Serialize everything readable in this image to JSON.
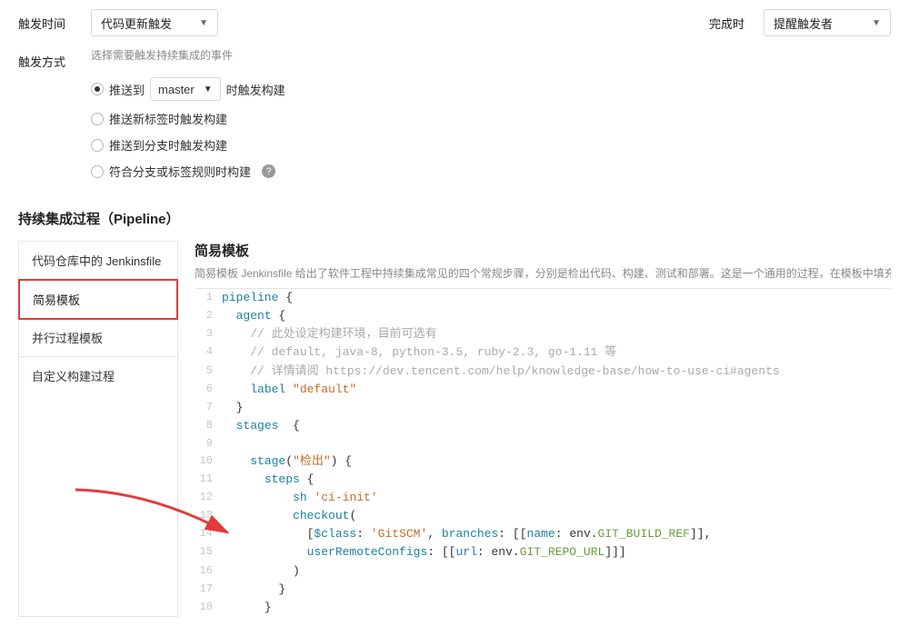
{
  "top": {
    "trigger_time_label": "触发时间",
    "trigger_time_value": "代码更新触发",
    "complete_label": "完成时",
    "complete_value": "提醒触发者"
  },
  "trigger_mode": {
    "label": "触发方式",
    "hint": "选择需要触发持续集成的事件",
    "opt1_prefix": "推送到",
    "opt1_branch": "master",
    "opt1_suffix": "时触发构建",
    "opt2": "推送新标签时触发构建",
    "opt3": "推送到分支时触发构建",
    "opt4": "符合分支或标签规则时构建"
  },
  "pipeline": {
    "heading": "持续集成过程（Pipeline）",
    "tabs": [
      "代码仓库中的 Jenkinsfile",
      "简易模板",
      "并行过程模板",
      "自定义构建过程"
    ],
    "content_title": "简易模板",
    "content_desc": "简易模板 Jenkinsfile 给出了软件工程中持续集成常见的四个常规步骤，分别是检出代码、构建、测试和部署。这是一个通用的过程，在模板中填充上对应的真实构建和部署过程即可轻松完成整个持续集"
  },
  "code": [
    {
      "n": "1",
      "t": "pipeline {",
      "c": "kw"
    },
    {
      "n": "2",
      "t": "  agent {",
      "c": "kw"
    },
    {
      "n": "3",
      "t": "    // 此处设定构建环境，目前可选有",
      "c": "cm"
    },
    {
      "n": "4",
      "t": "    // default, java-8, python-3.5, ruby-2.3, go-1.11 等",
      "c": "cm"
    },
    {
      "n": "5",
      "t": "    // 详情请阅 https://dev.tencent.com/help/knowledge-base/how-to-use-ci#agents",
      "c": "cm"
    },
    {
      "n": "6",
      "t": "    label \"default\"",
      "c": "label"
    },
    {
      "n": "7",
      "t": "  }",
      "c": "plain"
    },
    {
      "n": "8",
      "t": "  stages  {",
      "c": "kw"
    },
    {
      "n": "9",
      "t": "",
      "c": "plain"
    },
    {
      "n": "10",
      "t": "    stage(\"检出\") {",
      "c": "stage"
    },
    {
      "n": "11",
      "t": "      steps {",
      "c": "kw"
    },
    {
      "n": "12",
      "t": "          sh 'ci-init'",
      "c": "sh"
    },
    {
      "n": "13",
      "t": "          checkout(",
      "c": "kw"
    },
    {
      "n": "14",
      "t": "            [$class: 'GitSCM', branches: [[name: env.GIT_BUILD_REF]],",
      "c": "checkout1"
    },
    {
      "n": "15",
      "t": "            userRemoteConfigs: [[url: env.GIT_REPO_URL]]]",
      "c": "checkout2"
    },
    {
      "n": "16",
      "t": "          )",
      "c": "plain"
    },
    {
      "n": "17",
      "t": "        }",
      "c": "plain"
    },
    {
      "n": "18",
      "t": "      }",
      "c": "plain"
    }
  ]
}
